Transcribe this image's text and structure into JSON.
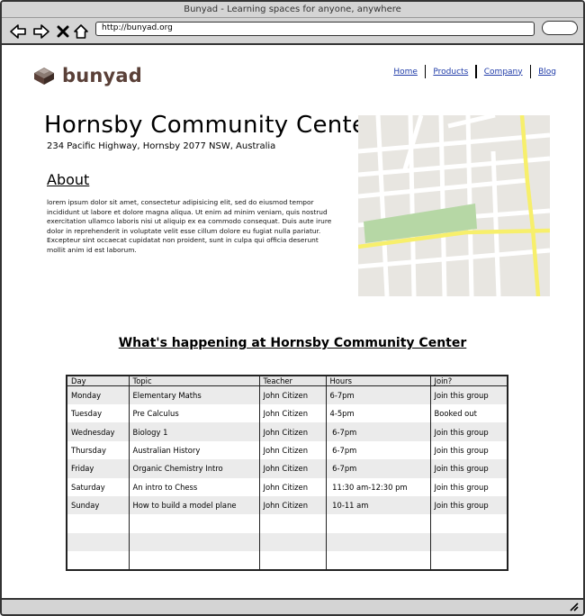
{
  "window": {
    "title": "Bunyad - Learning spaces for anyone, anywhere"
  },
  "browser": {
    "url": "http://bunyad.org",
    "back_icon": "arrow-left-icon",
    "forward_icon": "arrow-right-icon",
    "stop_icon": "close-icon",
    "home_icon": "home-icon"
  },
  "site": {
    "logo_text": "bunyad",
    "brand_color": "#5a4038",
    "nav": [
      "Home",
      "Products",
      "Company",
      "Blog"
    ]
  },
  "center": {
    "name": "Hornsby Community Center",
    "address": "234 Pacific Highway, Hornsby 2077 NSW, Australia",
    "about_heading": "About",
    "about_text": "lorem ipsum dolor sit amet, consectetur adipisicing elit, sed do eiusmod tempor incididunt ut labore et dolore magna aliqua. Ut enim ad minim veniam, quis nostrud exercitation ullamco laboris nisi ut aliquip ex ea commodo consequat. Duis aute irure dolor in reprehenderit in voluptate velit esse cillum dolore eu fugiat nulla pariatur. Excepteur sint occaecat cupidatat non proident, sunt in culpa qui officia deserunt mollit anim id est laborum."
  },
  "schedule": {
    "heading": "What's happening at Hornsby Community Center",
    "columns": [
      "Day",
      "Topic",
      "Teacher",
      "Hours",
      "Join?"
    ],
    "rows": [
      [
        "Monday",
        "Elementary Maths",
        "John Citizen",
        "6-7pm",
        "Join this group"
      ],
      [
        "Tuesday",
        "Pre Calculus",
        "John Citizen",
        "4-5pm",
        "Booked out"
      ],
      [
        "Wednesday",
        "Biology 1",
        "John Citizen",
        " 6-7pm",
        "Join this group"
      ],
      [
        "Thursday",
        "Australian History",
        "John Citizen",
        " 6-7pm",
        "Join this group"
      ],
      [
        "Friday",
        "Organic Chemistry Intro",
        "John Citizen",
        " 6-7pm",
        "Join this group"
      ],
      [
        "Saturday",
        "An intro to Chess",
        "John Citizen",
        " 11:30 am-12:30 pm",
        "Join this group"
      ],
      [
        "Sunday",
        "How to build a model plane",
        "John Citizen",
        " 10-11 am",
        "Join this group"
      ],
      [
        "",
        "",
        "",
        "",
        ""
      ],
      [
        "",
        "",
        "",
        "",
        ""
      ],
      [
        "",
        "",
        "",
        "",
        ""
      ]
    ]
  },
  "colors": {
    "map_bg": "#e8e6e1",
    "map_road": "#ffffff",
    "map_highway": "#f7ef6b",
    "map_park": "#b6d7a5",
    "link": "#1f3ba8"
  }
}
